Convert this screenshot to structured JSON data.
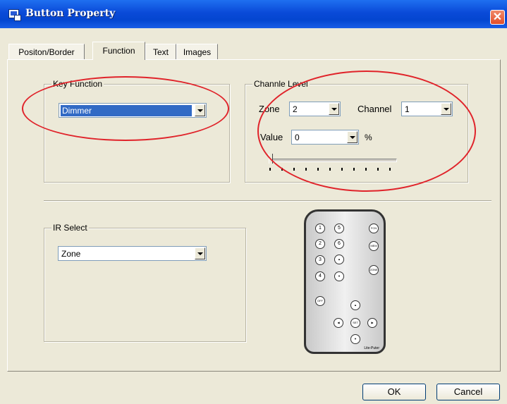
{
  "window": {
    "title": "Button Property",
    "close_glyph": "✕"
  },
  "tabs": [
    {
      "label": "Positon/Border"
    },
    {
      "label": "Function"
    },
    {
      "label": "Text"
    },
    {
      "label": "Images"
    }
  ],
  "key_function": {
    "label": "Key Function",
    "value": "Dimmer"
  },
  "channel_level": {
    "label": "Channle Level",
    "zone_label": "Zone",
    "zone_value": "2",
    "channel_label": "Channel",
    "channel_value": "1",
    "value_label": "Value",
    "value_value": "0",
    "unit": "%",
    "slider_level": 0
  },
  "ir_select": {
    "label": "IR Select",
    "value": "Zone"
  },
  "remote": {
    "buttons": [
      "1",
      "5",
      "FCN",
      "2",
      "6",
      "MEM",
      "3",
      "▲",
      "4",
      "▼",
      "ZONE",
      "OFF",
      "▲",
      "◀",
      "SET",
      "▶",
      "▼"
    ],
    "brand": "Lite-Puter"
  },
  "footer": {
    "ok_label": "OK",
    "cancel_label": "Cancel"
  },
  "colors": {
    "title_bar": "#0a4ad8",
    "annotation": "#e0232a",
    "dialog_bg": "#ece9d8"
  }
}
